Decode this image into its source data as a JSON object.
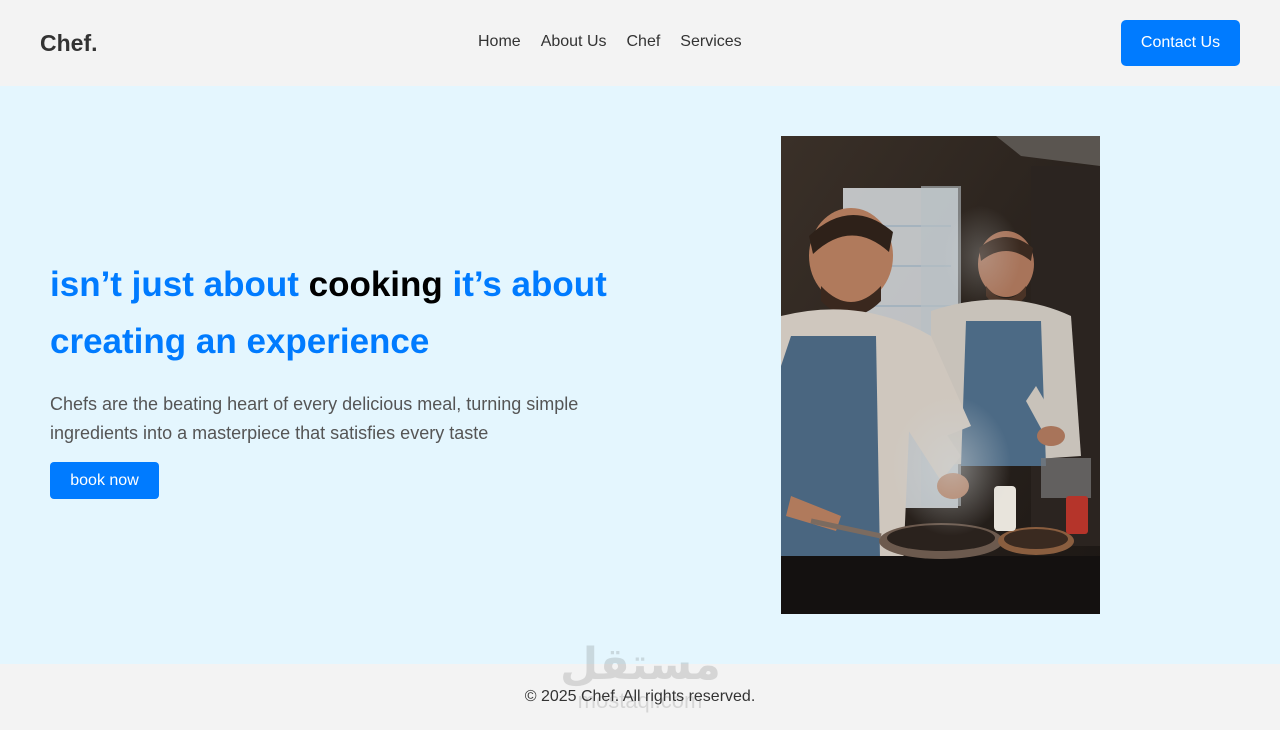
{
  "brand": {
    "logo": "Chef."
  },
  "nav": {
    "items": [
      "Home",
      "About Us",
      "Chef",
      "Services"
    ]
  },
  "header": {
    "contact_label": "Contact Us"
  },
  "hero": {
    "title_part1": "isn’t just about ",
    "title_highlight": "cooking",
    "title_part2": " it’s about creating an experience",
    "description": "Chefs are the beating heart of every delicious meal, turning simple ingredients into a masterpiece that satisfies every taste",
    "cta_label": "book now"
  },
  "footer": {
    "copyright": "© 2025 Chef. All rights reserved."
  },
  "watermark": {
    "arabic": "مستقل",
    "latin": "mostaql.com"
  },
  "colors": {
    "accent": "#007bff",
    "hero_bg": "#e4f6fe",
    "header_bg": "#f3f3f3"
  }
}
